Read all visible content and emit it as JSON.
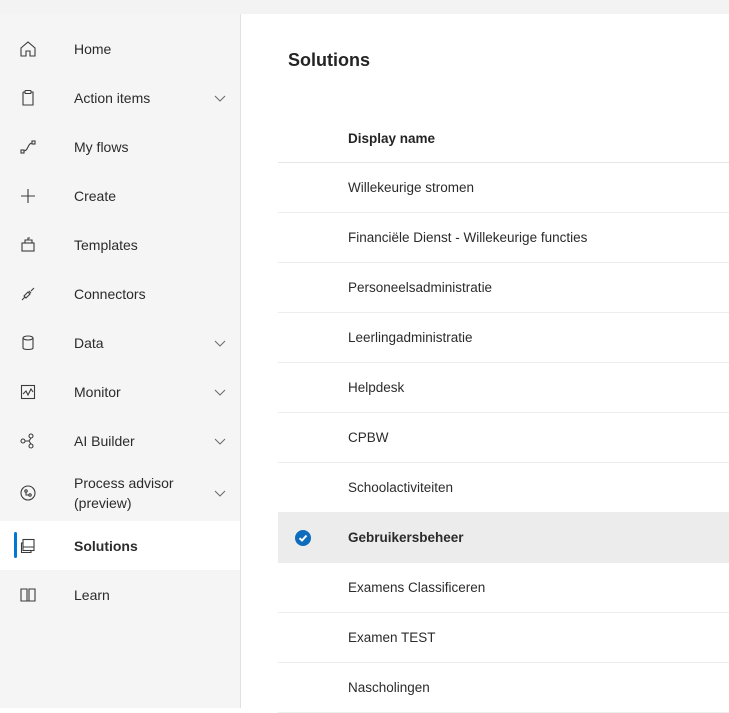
{
  "sidebar": {
    "items": [
      {
        "label": "Home",
        "icon": "home-icon",
        "expandable": false
      },
      {
        "label": "Action items",
        "icon": "clipboard-icon",
        "expandable": true
      },
      {
        "label": "My flows",
        "icon": "flow-icon",
        "expandable": false
      },
      {
        "label": "Create",
        "icon": "plus-icon",
        "expandable": false
      },
      {
        "label": "Templates",
        "icon": "templates-icon",
        "expandable": false
      },
      {
        "label": "Connectors",
        "icon": "connector-icon",
        "expandable": false
      },
      {
        "label": "Data",
        "icon": "database-icon",
        "expandable": true
      },
      {
        "label": "Monitor",
        "icon": "monitor-icon",
        "expandable": true
      },
      {
        "label": "AI Builder",
        "icon": "ai-builder-icon",
        "expandable": true
      },
      {
        "label": "Process advisor (preview)",
        "icon": "process-advisor-icon",
        "expandable": true
      },
      {
        "label": "Solutions",
        "icon": "solutions-icon",
        "expandable": false,
        "active": true
      },
      {
        "label": "Learn",
        "icon": "book-icon",
        "expandable": false
      }
    ],
    "accent_color": "#0078d4"
  },
  "main": {
    "title": "Solutions",
    "table": {
      "column_header": "Display name",
      "rows": [
        {
          "name": "Willekeurige stromen"
        },
        {
          "name": "Financiële Dienst - Willekeurige functies"
        },
        {
          "name": "Personeelsadministratie"
        },
        {
          "name": "Leerlingadministratie"
        },
        {
          "name": "Helpdesk"
        },
        {
          "name": "CPBW"
        },
        {
          "name": "Schoolactiviteiten"
        },
        {
          "name": "Gebruikersbeheer",
          "selected": true
        },
        {
          "name": "Examens Classificeren"
        },
        {
          "name": "Examen TEST"
        },
        {
          "name": "Nascholingen"
        }
      ]
    }
  }
}
